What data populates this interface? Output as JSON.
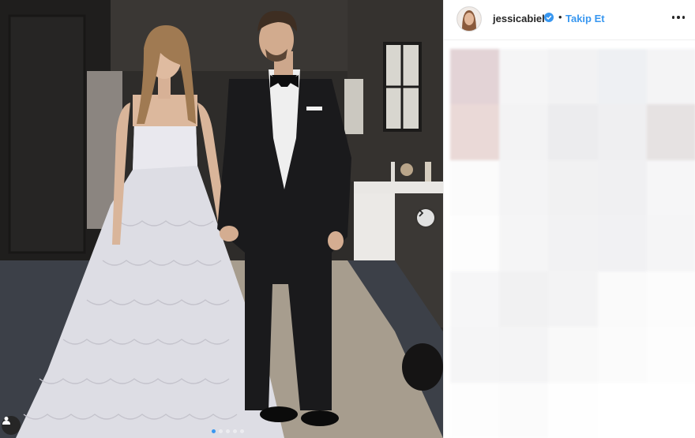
{
  "post": {
    "image_alt": "Couple posing in a room: woman in white strapless layered gown, man in black tuxedo with bow tie",
    "carousel": {
      "slide_count": 5,
      "active_index": 0
    }
  },
  "header": {
    "username": "jessicabiel",
    "verified": true,
    "separator": "•",
    "follow_label": "Takip Et"
  },
  "icons": {
    "next": "chevron-right-icon",
    "user_tag": "user-tag-icon",
    "more": "more-options-icon",
    "verified": "verified-badge-icon"
  },
  "colors": {
    "link_blue": "#3897f0",
    "verified_blue": "#3897f0",
    "text_dark": "#262626",
    "border": "#efefef"
  },
  "mosaic_colors": [
    "#e3d3d6",
    "#f5f5f6",
    "#f2f2f3",
    "#eef0f3",
    "#f4f4f5",
    "#ead9d7",
    "#f3f3f4",
    "#ececee",
    "#efeff1",
    "#e6e2e2",
    "#fbfbfb",
    "#f4f4f5",
    "#f1f1f2",
    "#f0f0f2",
    "#f6f6f7",
    "#fdfdfd",
    "#f5f5f6",
    "#f2f2f3",
    "#f1f1f3",
    "#f5f5f6",
    "#f6f6f7",
    "#f1f1f2",
    "#f3f3f4",
    "#fafafa",
    "#fcfcfc",
    "#f5f5f6",
    "#f4f4f5",
    "#f9f9f9",
    "#fbfbfb",
    "#fdfdfd",
    "#fdfdfd",
    "#fbfbfb",
    "#fefefe",
    "#ffffff",
    "#ffffff"
  ]
}
